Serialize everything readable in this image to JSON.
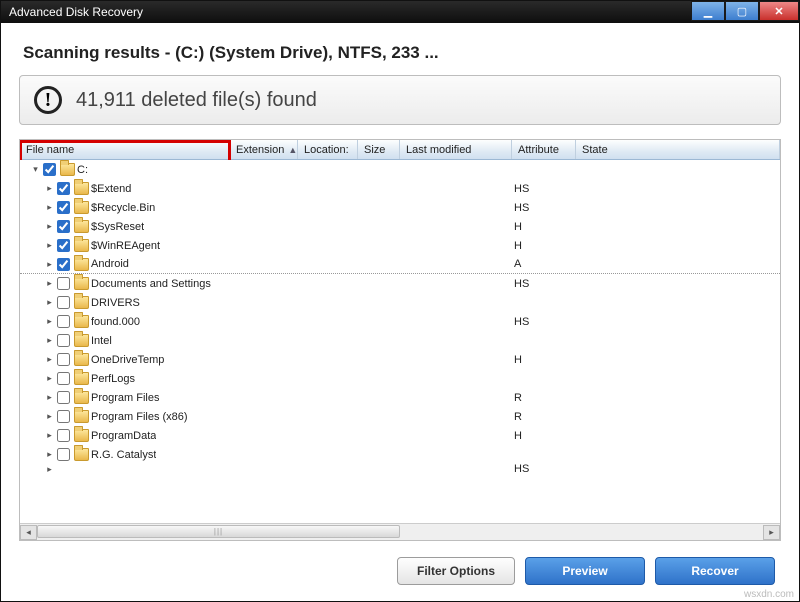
{
  "window": {
    "title": "Advanced Disk Recovery"
  },
  "heading": "Scanning results - (C:)  (System Drive), NTFS, 233 ...",
  "summary": "41,911 deleted file(s) found",
  "columns": {
    "name": "File name",
    "ext": "Extension",
    "loc": "Location:",
    "size": "Size",
    "mod": "Last modified",
    "attr": "Attribute",
    "state": "State"
  },
  "rows": [
    {
      "name": "C:",
      "checked": true,
      "root": true,
      "dotted": false,
      "attr": "",
      "expander": "▾"
    },
    {
      "name": "$Extend",
      "checked": true,
      "root": false,
      "dotted": false,
      "attr": "HS",
      "expander": "▸"
    },
    {
      "name": "$Recycle.Bin",
      "checked": true,
      "root": false,
      "dotted": false,
      "attr": "HS",
      "expander": "▸"
    },
    {
      "name": "$SysReset",
      "checked": true,
      "root": false,
      "dotted": false,
      "attr": "H",
      "expander": "▸"
    },
    {
      "name": "$WinREAgent",
      "checked": true,
      "root": false,
      "dotted": false,
      "attr": "H",
      "expander": "▸"
    },
    {
      "name": "Android",
      "checked": true,
      "root": false,
      "dotted": true,
      "attr": "A",
      "expander": "▸"
    },
    {
      "name": "Documents and Settings",
      "checked": false,
      "root": false,
      "dotted": false,
      "attr": "HS",
      "expander": "▸"
    },
    {
      "name": "DRIVERS",
      "checked": false,
      "root": false,
      "dotted": false,
      "attr": "",
      "expander": "▸"
    },
    {
      "name": "found.000",
      "checked": false,
      "root": false,
      "dotted": false,
      "attr": "HS",
      "expander": "▸"
    },
    {
      "name": "Intel",
      "checked": false,
      "root": false,
      "dotted": false,
      "attr": "",
      "expander": "▸"
    },
    {
      "name": "OneDriveTemp",
      "checked": false,
      "root": false,
      "dotted": false,
      "attr": "H",
      "expander": "▸"
    },
    {
      "name": "PerfLogs",
      "checked": false,
      "root": false,
      "dotted": false,
      "attr": "",
      "expander": "▸"
    },
    {
      "name": "Program Files",
      "checked": false,
      "root": false,
      "dotted": false,
      "attr": "R",
      "expander": "▸"
    },
    {
      "name": "Program Files (x86)",
      "checked": false,
      "root": false,
      "dotted": false,
      "attr": "R",
      "expander": "▸"
    },
    {
      "name": "ProgramData",
      "checked": false,
      "root": false,
      "dotted": false,
      "attr": "H",
      "expander": "▸"
    },
    {
      "name": "R.G. Catalyst",
      "checked": false,
      "root": false,
      "dotted": false,
      "attr": "",
      "expander": "▸"
    }
  ],
  "partial_attr": "HS",
  "buttons": {
    "filter": "Filter Options",
    "preview": "Preview",
    "recover": "Recover"
  },
  "watermark": "wsxdn.com"
}
